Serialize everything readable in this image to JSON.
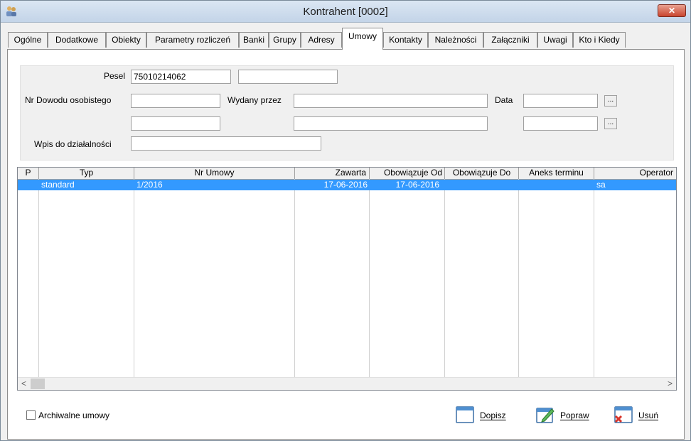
{
  "window": {
    "title": "Kontrahent [0002]",
    "close_glyph": "✕",
    "app_icon": "users-icon"
  },
  "tabs": [
    {
      "label": "Ogólne"
    },
    {
      "label": "Dodatkowe"
    },
    {
      "label": "Obiekty"
    },
    {
      "label": "Parametry rozliczeń"
    },
    {
      "label": "Banki"
    },
    {
      "label": "Grupy"
    },
    {
      "label": "Adresy"
    },
    {
      "label": "Umowy",
      "active": true
    },
    {
      "label": "Kontakty"
    },
    {
      "label": "Należności"
    },
    {
      "label": "Załączniki"
    },
    {
      "label": "Uwagi"
    },
    {
      "label": "Kto i Kiedy"
    }
  ],
  "form": {
    "pesel_label": "Pesel",
    "pesel_value": "75010214062",
    "pesel_extra_value": "",
    "dowod_label": "Nr Dowodu osobistego",
    "dowod_value": "",
    "dowod2_value": "",
    "wydany_label": "Wydany przez",
    "wydany_value": "",
    "wydany2_value": "",
    "data_label": "Data",
    "data_value": "",
    "data2_value": "",
    "dots_label": "...",
    "wpis_label": "Wpis do działalności",
    "wpis_value": ""
  },
  "grid": {
    "columns": [
      "P",
      "Typ",
      "Nr Umowy",
      "Zawarta",
      "Obowiązuje Od",
      "Obowiązuje Do",
      "Aneks terminu",
      "Operator"
    ],
    "rows": [
      {
        "p": "",
        "typ": "standard",
        "nr_umowy": "1/2016",
        "zawarta": "17-06-2016",
        "od": "17-06-2016",
        "do": "",
        "aneks": "",
        "operator": "sa",
        "selected": true
      }
    ],
    "scroll_left": "<",
    "scroll_right": ">"
  },
  "footer": {
    "archiwalne_label": "Archiwalne umowy",
    "archiwalne_checked": false,
    "dopisz_label": "Dopisz",
    "popraw_label": "Popraw",
    "usun_label": "Usuń"
  },
  "colors": {
    "selection": "#3399ff",
    "close_button": "#c9452f"
  }
}
